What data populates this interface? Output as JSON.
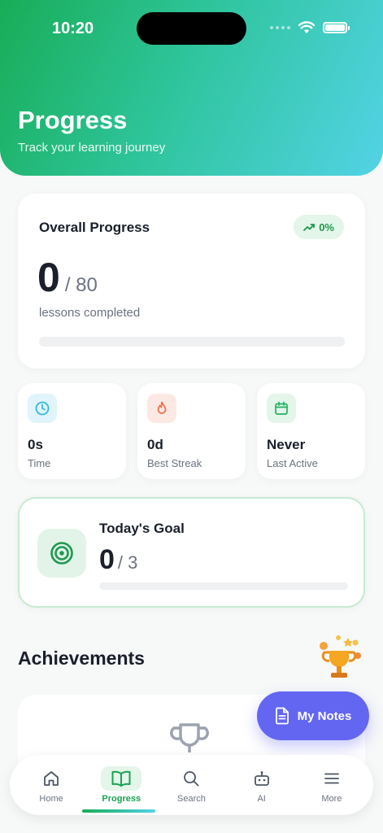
{
  "status": {
    "time": "10:20"
  },
  "header": {
    "title": "Progress",
    "subtitle": "Track your learning journey"
  },
  "overall": {
    "title": "Overall Progress",
    "trend": "0%",
    "completed": "0",
    "total": "/ 80",
    "label": "lessons completed",
    "progress_fraction": 0
  },
  "stats": [
    {
      "icon": "clock-icon",
      "value": "0s",
      "label": "Time",
      "color": "#36b7e0",
      "bg": "#e1f4fb"
    },
    {
      "icon": "flame-icon",
      "value": "0d",
      "label": "Best Streak",
      "color": "#ef6a4a",
      "bg": "#fde9e3"
    },
    {
      "icon": "calendar-icon",
      "value": "Never",
      "label": "Last Active",
      "color": "#22b35e",
      "bg": "#e4f5ea"
    }
  ],
  "goal": {
    "title": "Today's Goal",
    "done": "0",
    "total": "/ 3",
    "progress_fraction": 0
  },
  "achievements": {
    "title": "Achievements"
  },
  "fab": {
    "label": "My Notes"
  },
  "nav": {
    "items": [
      {
        "label": "Home",
        "icon": "home-icon"
      },
      {
        "label": "Progress",
        "icon": "book-icon",
        "active": true
      },
      {
        "label": "Search",
        "icon": "search-icon"
      },
      {
        "label": "AI",
        "icon": "robot-icon"
      },
      {
        "label": "More",
        "icon": "menu-icon"
      }
    ]
  },
  "colors": {
    "accent": "#22b35e",
    "fab": "#6366f1"
  }
}
